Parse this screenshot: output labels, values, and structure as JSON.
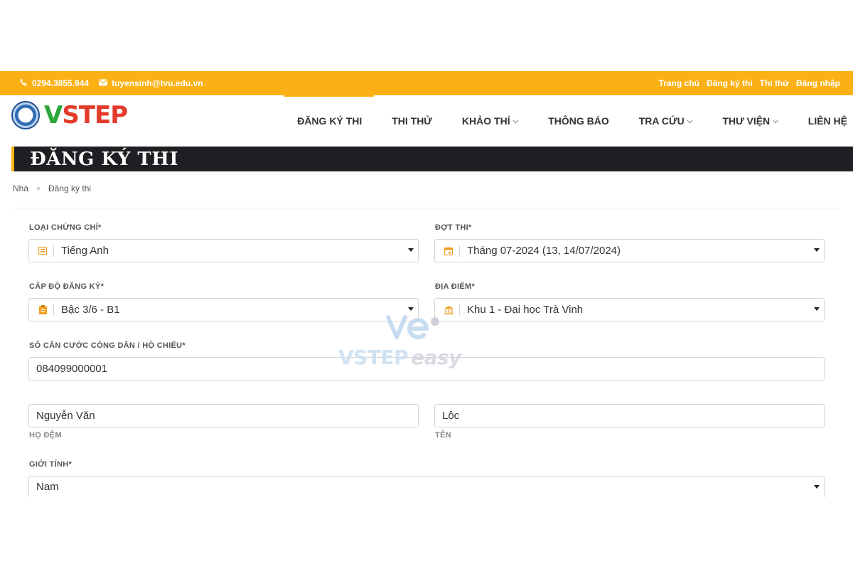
{
  "topbar": {
    "phone": "0294.3855.944",
    "email": "tuyensinh@tvu.edu.vn",
    "links": [
      "Trang chủ",
      "Đăng ký thi",
      "Thi thử",
      "Đăng nhập"
    ]
  },
  "logo": {
    "text_v": "V",
    "text_rest": "STEP"
  },
  "nav": [
    {
      "label": "ĐĂNG KÝ THI",
      "dropdown": false,
      "active": true
    },
    {
      "label": "THI THỬ",
      "dropdown": false
    },
    {
      "label": "KHẢO THÍ",
      "dropdown": true
    },
    {
      "label": "THÔNG BÁO",
      "dropdown": false
    },
    {
      "label": "TRA CỨU",
      "dropdown": true
    },
    {
      "label": "THƯ VIỆN",
      "dropdown": true
    },
    {
      "label": "LIÊN HỆ",
      "dropdown": false
    }
  ],
  "page_title": "ĐĂNG KÝ THI",
  "breadcrumb": {
    "home": "Nhà",
    "current": "Đăng ký thi"
  },
  "form": {
    "certificate": {
      "label": "LOẠI CHỨNG CHỈ*",
      "value": "Tiếng Anh",
      "icon": "certificate-icon"
    },
    "session": {
      "label": "ĐỢT THI*",
      "value": "Tháng 07-2024 (13, 14/07/2024)",
      "icon": "calendar-icon"
    },
    "level": {
      "label": "CẤP ĐỘ ĐĂNG KÝ*",
      "value": "Bậc 3/6 - B1",
      "icon": "clipboard-icon"
    },
    "location": {
      "label": "ĐỊA ĐIỂM*",
      "value": "Khu 1 - Đại học Trà Vinh",
      "icon": "building-icon"
    },
    "id_number": {
      "label": "SỐ CĂN CƯỚC CÔNG DÂN / HỘ CHIẾU*",
      "value": "084099000001"
    },
    "middle_name": {
      "value": "Nguyễn Văn",
      "caption": "HỌ ĐỆM"
    },
    "first_name": {
      "value": "Lộc",
      "caption": "TÊN"
    },
    "gender": {
      "label": "GIỚI TÍNH*",
      "value": "Nam"
    }
  },
  "watermark": {
    "brand": "VSTEP",
    "suffix": "easy"
  },
  "colors": {
    "accent": "#fbb116",
    "title_bar": "#1f1f23"
  }
}
